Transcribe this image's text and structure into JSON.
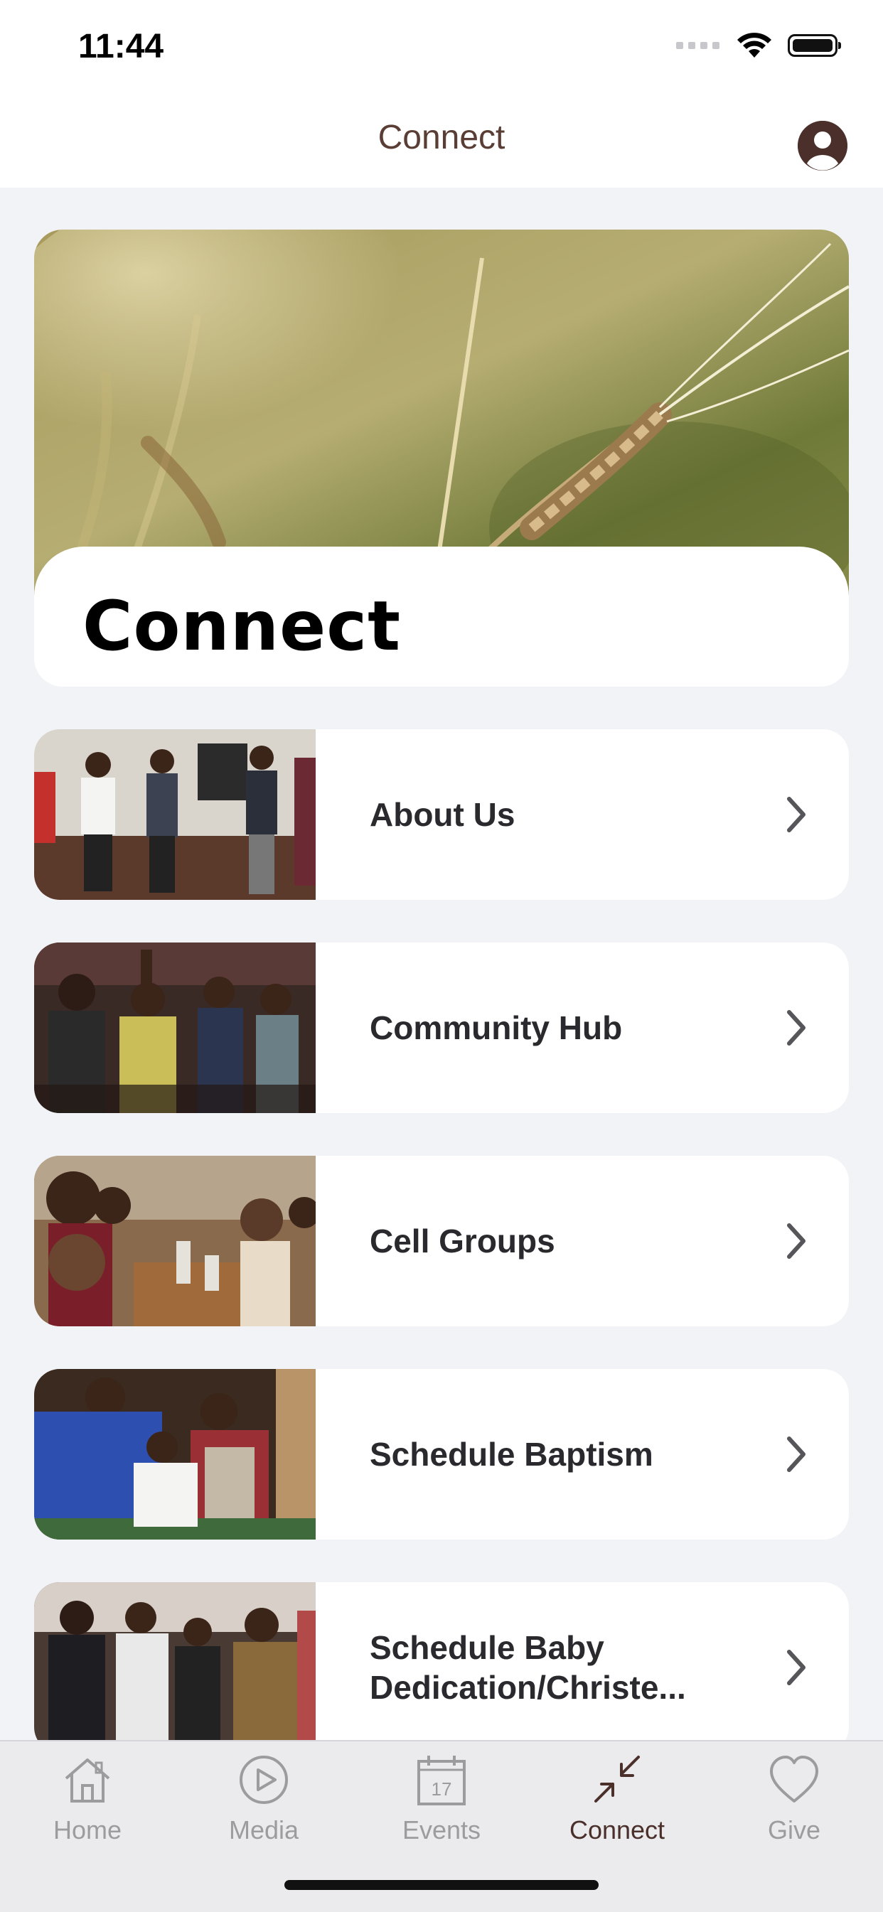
{
  "status_bar": {
    "time": "11:44"
  },
  "nav": {
    "title": "Connect"
  },
  "hero": {
    "title": "Connect"
  },
  "list": [
    {
      "label": "About Us"
    },
    {
      "label": "Community Hub"
    },
    {
      "label": "Cell Groups"
    },
    {
      "label": "Schedule Baptism"
    },
    {
      "label_line1": "Schedule Baby",
      "label_line2": "Dedication/Christe..."
    }
  ],
  "tabs": [
    {
      "label": "Home",
      "icon": "home-icon"
    },
    {
      "label": "Media",
      "icon": "play-icon"
    },
    {
      "label": "Events",
      "icon": "calendar-icon",
      "calendar_day": "17"
    },
    {
      "label": "Connect",
      "icon": "connect-icon",
      "active": true
    },
    {
      "label": "Give",
      "icon": "heart-icon"
    }
  ],
  "colors": {
    "accent": "#4a2f2a",
    "nav_title": "#5a3e36",
    "background": "#f2f3f7",
    "tab_inactive": "#9c9c9f"
  }
}
